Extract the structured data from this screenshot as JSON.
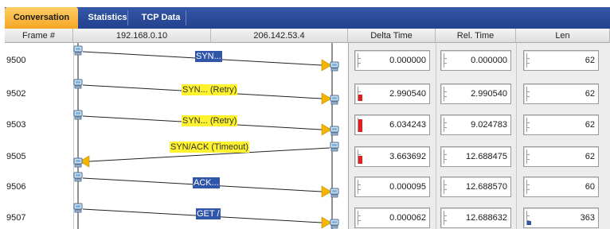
{
  "tabs": [
    {
      "label": "Conversation",
      "active": true
    },
    {
      "label": "Statistics",
      "active": false
    },
    {
      "label": "TCP Data",
      "active": false
    }
  ],
  "columns": {
    "frame": "Frame #",
    "host_a": "192.168.0.10",
    "host_b": "206.142.53.4",
    "delta": "Delta Time",
    "rel": "Rel. Time",
    "len": "Len"
  },
  "rows": [
    {
      "frame": "9500",
      "direction": "right",
      "label": "SYN...",
      "label_style": "blue",
      "delta": "0.000000",
      "rel": "0.000000",
      "len": "62",
      "delta_level": 0,
      "len_level": 0
    },
    {
      "frame": "9502",
      "direction": "right",
      "label": "SYN... (Retry)",
      "label_style": "yellow",
      "delta": "2.990540",
      "rel": "2.990540",
      "len": "62",
      "delta_level": 0.45,
      "len_level": 0
    },
    {
      "frame": "9503",
      "direction": "right",
      "label": "SYN... (Retry)",
      "label_style": "yellow",
      "delta": "6.034243",
      "rel": "9.024783",
      "len": "62",
      "delta_level": 0.9,
      "len_level": 0
    },
    {
      "frame": "9505",
      "direction": "left",
      "label": "SYN/ACK (Timeout)",
      "label_style": "yellow",
      "delta": "3.663692",
      "rel": "12.688475",
      "len": "62",
      "delta_level": 0.55,
      "len_level": 0
    },
    {
      "frame": "9506",
      "direction": "right",
      "label": "ACK...",
      "label_style": "blue",
      "delta": "0.000095",
      "rel": "12.688570",
      "len": "60",
      "delta_level": 0,
      "len_level": 0
    },
    {
      "frame": "9507",
      "direction": "right",
      "label": "GET /",
      "label_style": "blue",
      "delta": "0.000062",
      "rel": "12.688632",
      "len": "363",
      "delta_level": 0,
      "len_level": 0.3
    }
  ],
  "colors": {
    "tabbar": "#22418e",
    "active_tab": "#f5a623",
    "label_blue": "#2f56a8",
    "label_yellow": "#fff22e",
    "arrow": "#f5b400",
    "delta_bar": "#e02020",
    "len_bar": "#2f56a8"
  },
  "icons": {
    "host": "computer-icon",
    "arrow": "arrowhead-icon"
  }
}
